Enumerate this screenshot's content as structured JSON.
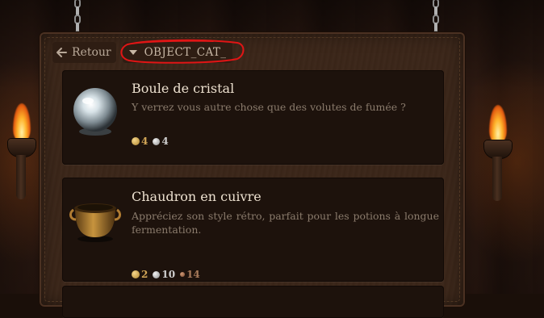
{
  "header": {
    "back_label": "Retour",
    "category_label": "OBJECT_CAT_"
  },
  "items": [
    {
      "name": "Boule de cristal",
      "description": "Y verrez vous autre chose que des volutes de fumée ?",
      "price": {
        "gold": "4",
        "silver": "4"
      }
    },
    {
      "name": "Chaudron en cuivre",
      "description": "Appréciez son style rétro, parfait pour les potions à longue fermentation.",
      "price": {
        "gold": "2",
        "silver": "10",
        "copper": "14"
      }
    }
  ],
  "colors": {
    "accent_gold": "#d2a656",
    "silver": "#cfcfcf",
    "copper": "#a87a5a",
    "annotation_red": "#e01515"
  },
  "icons": [
    "back-arrow-icon",
    "dropdown-caret-icon",
    "gold-coin-icon",
    "silver-coin-icon",
    "copper-coin-icon"
  ]
}
